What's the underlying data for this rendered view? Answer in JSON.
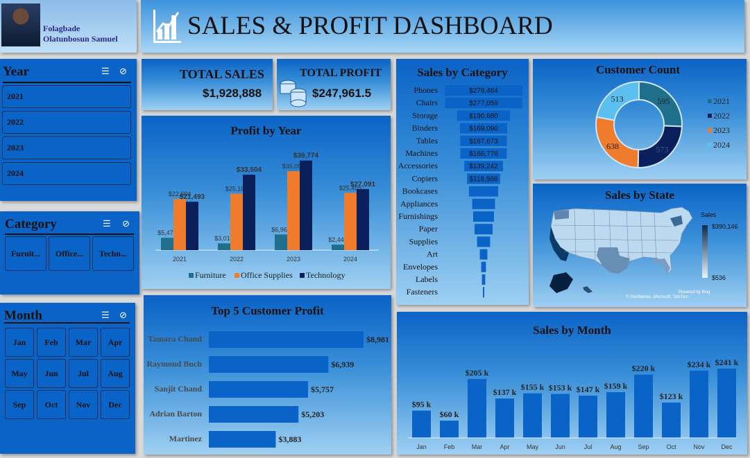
{
  "profile": {
    "name_line1": "Folagbade",
    "name_line2": "Olatunbosun Samuel"
  },
  "header": {
    "title": "SALES & PROFIT DASHBOARD"
  },
  "year_slicer": {
    "title": "Year",
    "items": [
      "2021",
      "2022",
      "2023",
      "2024"
    ]
  },
  "category_slicer": {
    "title": "Category",
    "items": [
      "Furnit...",
      "Office...",
      "Techn..."
    ]
  },
  "month_slicer": {
    "title": "Month",
    "items": [
      "Jan",
      "Feb",
      "Mar",
      "Apr",
      "May",
      "Jun",
      "Jul",
      "Aug",
      "Sep",
      "Oct",
      "Nov",
      "Dec"
    ]
  },
  "kpi": {
    "sales_label": "TOTAL SALES",
    "sales_value": "$1,928,888",
    "profit_label": "TOTAL PROFIT",
    "profit_value": "$247,961.5"
  },
  "colors": {
    "furniture": "#1f6e8c",
    "office": "#ef7b2d",
    "technology": "#0b1f5c",
    "bar": "#0a63c6"
  },
  "chart_data": [
    {
      "type": "bar",
      "id": "profit_by_year",
      "title": "Profit by Year",
      "categories": [
        "2021",
        "2022",
        "2023",
        "2024"
      ],
      "series": [
        {
          "name": "Furniture",
          "values": [
            5470,
            3015,
            6960,
            2444
          ],
          "labels": [
            "$5,470",
            "$3,015",
            "$6,960",
            "$2,444"
          ]
        },
        {
          "name": "Office Supplies",
          "values": [
            22694,
            25100,
            35093,
            25455
          ],
          "labels": [
            "$22,694",
            "$25,100",
            "$35,093",
            "$25,455"
          ]
        },
        {
          "name": "Technology",
          "values": [
            21493,
            33504,
            39774,
            27091
          ],
          "labels": [
            "$21,493",
            "$33,504",
            "$39,774",
            "$27,091"
          ]
        }
      ],
      "legend": "bottom"
    },
    {
      "type": "bar",
      "id": "sales_by_category",
      "title": "Sales by Category",
      "orientation": "horizontal-funnel",
      "categories": [
        "Phones",
        "Chairs",
        "Storage",
        "Binders",
        "Tables",
        "Machines",
        "Accessories",
        "Copiers",
        "Bookcases",
        "Appliances",
        "Furnishings",
        "Paper",
        "Supplies",
        "Art",
        "Envelopes",
        "Labels",
        "Fasteners"
      ],
      "values": [
        279464,
        277059,
        190680,
        169090,
        167673,
        166778,
        139242,
        118968,
        105000,
        82000,
        75000,
        65000,
        47000,
        27000,
        17000,
        12000,
        3000
      ],
      "labels": [
        "$279,464",
        "$277,059",
        "$190,680",
        "$169,090",
        "$167,673",
        "$166,778",
        "$139,242",
        "$118,968",
        "",
        "",
        "",
        "",
        "",
        "",
        "",
        "",
        ""
      ]
    },
    {
      "type": "pie",
      "id": "customer_count",
      "title": "Customer Count",
      "categories": [
        "2021",
        "2022",
        "2023",
        "2024"
      ],
      "values": [
        595,
        573,
        638,
        513
      ],
      "labels": [
        "595",
        "573",
        "638",
        "513"
      ],
      "legend": "right"
    },
    {
      "type": "map",
      "id": "sales_by_state",
      "title": "Sales by State",
      "legend_title": "Sales",
      "max_label": "$390,146",
      "min_label": "$536",
      "credit_1": "Powered by Bing",
      "credit_2": "© GeoNames, Microsoft, TomTom"
    },
    {
      "type": "bar",
      "id": "top5_customer_profit",
      "title": "Top 5 Customer Profit",
      "orientation": "horizontal",
      "categories": [
        "Tamara Chand",
        "Raymond Buch",
        "Sanjit Chand",
        "Adrian Barton",
        "Martinez"
      ],
      "values": [
        8981,
        6939,
        5757,
        5203,
        3883
      ],
      "labels": [
        "$8,981",
        "$6,939",
        "$5,757",
        "$5,203",
        "$3,883"
      ]
    },
    {
      "type": "bar",
      "id": "sales_by_month",
      "title": "Sales by Month",
      "categories": [
        "Jan",
        "Feb",
        "Mar",
        "Apr",
        "May",
        "Jun",
        "Jul",
        "Aug",
        "Sep",
        "Oct",
        "Nov",
        "Dec"
      ],
      "values": [
        95,
        60,
        205,
        137,
        155,
        153,
        147,
        159,
        220,
        123,
        234,
        241
      ],
      "labels": [
        "$95 k",
        "$60 k",
        "$205 k",
        "$137 k",
        "$155 k",
        "$153 k",
        "$147 k",
        "$159 k",
        "$220 k",
        "$123 k",
        "$234 k",
        "$241 k"
      ]
    }
  ]
}
